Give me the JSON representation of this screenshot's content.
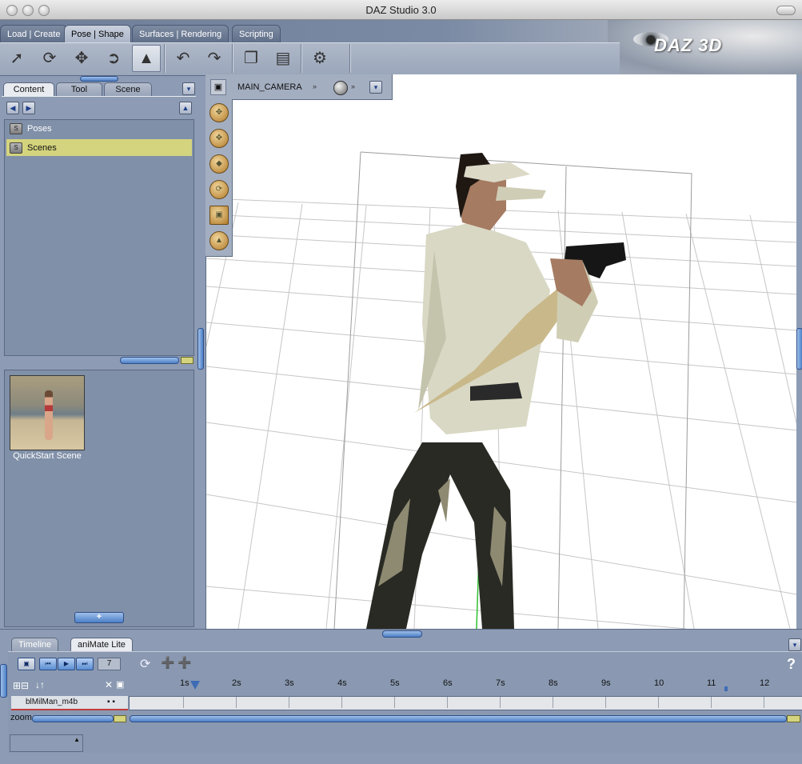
{
  "window": {
    "title": "DAZ Studio 3.0"
  },
  "logo": {
    "text": "DAZ 3D"
  },
  "main_tabs": [
    {
      "label": "Load | Create",
      "active": false
    },
    {
      "label": "Pose | Shape",
      "active": true
    },
    {
      "label": "Surfaces | Rendering",
      "active": false
    },
    {
      "label": "Scripting",
      "active": false
    }
  ],
  "toolbar": {
    "tools": [
      "select-icon",
      "rotate-icon",
      "translate-icon",
      "scale-icon",
      "universal-icon",
      "undo-icon",
      "redo-icon",
      "copy-icon",
      "paste-icon",
      "script-icon"
    ],
    "selected": "universal-icon"
  },
  "left_tabs": [
    {
      "label": "Content",
      "active": true
    },
    {
      "label": "Tool",
      "active": false
    },
    {
      "label": "Scene",
      "active": false
    }
  ],
  "content": {
    "folders": [
      {
        "label": "Poses",
        "selected": false
      },
      {
        "label": "Scenes",
        "selected": true
      }
    ],
    "thumbnails": [
      {
        "caption": "QuickStart Scene"
      }
    ],
    "add_button": "+"
  },
  "viewport": {
    "camera": "MAIN_CAMERA",
    "tools": [
      "orbit-icon",
      "pan-icon",
      "dolly-icon",
      "roll-icon",
      "frame-icon",
      "reset-icon"
    ]
  },
  "bottom_tabs": [
    {
      "label": "Timeline",
      "active": false
    },
    {
      "label": "aniMate Lite",
      "active": true
    }
  ],
  "animate": {
    "frame": "7",
    "ticks": [
      "1s",
      "2s",
      "3s",
      "4s",
      "5s",
      "6s",
      "7s",
      "8s",
      "9s",
      "10",
      "11",
      "12"
    ],
    "track_label": "blMilMan_m4b",
    "zoom_label": "zoom",
    "help": "?"
  },
  "colors": {
    "selected_item": "#d4d47e",
    "accent": "#4c7fc6",
    "panel": "#8d9cb4"
  }
}
